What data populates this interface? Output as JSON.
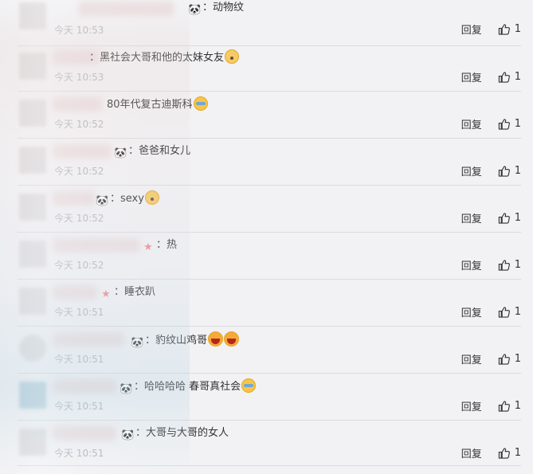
{
  "comments": [
    {
      "text": "动物纹",
      "badge": "🐼",
      "emojis": [],
      "time": "今天 10:53",
      "reply_label": "回复",
      "likes": "1"
    },
    {
      "text": "黑社会大哥和他的太妹女友",
      "badge": "",
      "emojis": [
        "dog"
      ],
      "time": "今天 10:53",
      "reply_label": "回复",
      "likes": "1"
    },
    {
      "text": "80年代复古迪斯科",
      "badge": "",
      "emojis": [
        "tear"
      ],
      "time": "今天 10:52",
      "reply_label": "回复",
      "likes": "1"
    },
    {
      "text": "爸爸和女儿",
      "badge": "🐼",
      "emojis": [],
      "time": "今天 10:52",
      "reply_label": "回复",
      "likes": "1"
    },
    {
      "text": "sexy",
      "badge": "🐼",
      "emojis": [
        "dog"
      ],
      "time": "今天 10:52",
      "reply_label": "回复",
      "likes": "1"
    },
    {
      "text": "热",
      "badge": "★",
      "emojis": [],
      "time": "今天 10:52",
      "reply_label": "回复",
      "likes": "1"
    },
    {
      "text": "睡衣趴",
      "badge": "★",
      "emojis": [],
      "time": "今天 10:51",
      "reply_label": "回复",
      "likes": "1"
    },
    {
      "text": "豹纹山鸡哥",
      "badge": "🐼",
      "emojis": [
        "big",
        "big"
      ],
      "time": "今天 10:51",
      "reply_label": "回复",
      "likes": "1"
    },
    {
      "text": "哈哈哈哈 春哥真社会",
      "badge": "🐼",
      "emojis": [
        "tear"
      ],
      "time": "今天 10:51",
      "reply_label": "回复",
      "likes": "1"
    },
    {
      "text": "大哥与大哥的女人",
      "badge": "🐼",
      "emojis": [],
      "time": "今天 10:51",
      "reply_label": "回复",
      "likes": "1"
    }
  ],
  "colors": {
    "background": "#f2f2f4",
    "divider": "#dcdcdf",
    "time": "#a3a3a8",
    "text": "#333333"
  },
  "icons": {
    "like": "thumbs-up-icon",
    "panda_badge": "panda-badge-icon",
    "star_badge": "star-badge-icon"
  }
}
